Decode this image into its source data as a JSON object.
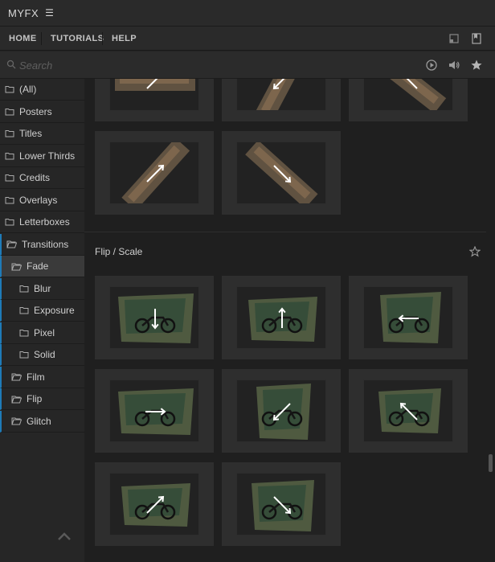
{
  "app": {
    "title": "MYFX"
  },
  "nav": {
    "tabs": [
      "HOME",
      "TUTORIALS",
      "HELP"
    ]
  },
  "search": {
    "placeholder": "Search"
  },
  "sidebar": {
    "items": [
      {
        "label": "(All)",
        "level": 0
      },
      {
        "label": "Posters",
        "level": 0
      },
      {
        "label": "Titles",
        "level": 0
      },
      {
        "label": "Lower Thirds",
        "level": 0
      },
      {
        "label": "Credits",
        "level": 0
      },
      {
        "label": "Overlays",
        "level": 0
      },
      {
        "label": "Letterboxes",
        "level": 0
      },
      {
        "label": "Transitions",
        "level": 0
      },
      {
        "label": "Fade",
        "level": 1
      },
      {
        "label": "Blur",
        "level": 2
      },
      {
        "label": "Exposure",
        "level": 2
      },
      {
        "label": "Pixel",
        "level": 2
      },
      {
        "label": "Solid",
        "level": 2
      },
      {
        "label": "Film",
        "level": 1
      },
      {
        "label": "Flip",
        "level": 1
      },
      {
        "label": "Glitch",
        "level": 1
      }
    ]
  },
  "sections": {
    "flip_scale": {
      "title": "Flip / Scale"
    }
  },
  "thumbnails": {
    "previous_section": [
      {
        "arrow": "up-right"
      },
      {
        "arrow": "down-left"
      },
      {
        "arrow": "up-left"
      },
      {
        "arrow": "up-right"
      },
      {
        "arrow": "down-right"
      }
    ],
    "flip_scale": [
      {
        "arrow": "down"
      },
      {
        "arrow": "up"
      },
      {
        "arrow": "left"
      },
      {
        "arrow": "right"
      },
      {
        "arrow": "down-left"
      },
      {
        "arrow": "up-left"
      },
      {
        "arrow": "up-right"
      },
      {
        "arrow": "down-right"
      }
    ]
  },
  "colors": {
    "accent": "#1e7bb8",
    "background": "#1f1f1f",
    "tile": "#2e2e2e"
  }
}
